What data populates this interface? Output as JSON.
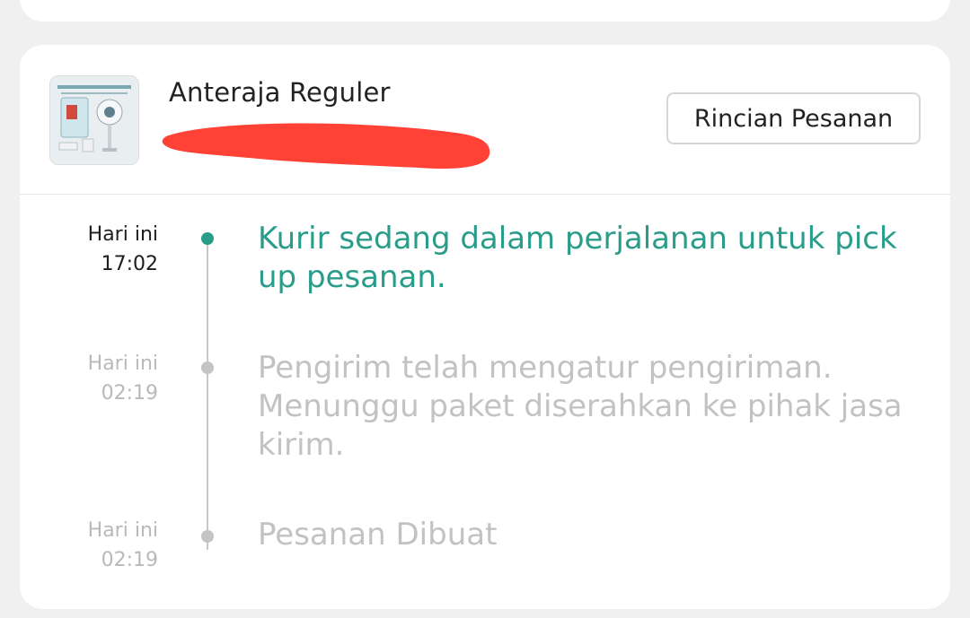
{
  "shipment": {
    "courier": "Anteraja Reguler",
    "details_button": "Rincian Pesanan"
  },
  "colors": {
    "active": "#2a9d8a",
    "inactive": "#c2c2c2",
    "redaction": "#ff4136"
  },
  "timeline": [
    {
      "date": "Hari ini",
      "time": "17:02",
      "text": "Kurir sedang dalam perjalanan untuk pick up pesanan.",
      "active": true
    },
    {
      "date": "Hari ini",
      "time": "02:19",
      "text": "Pengirim telah mengatur pengiriman. Menunggu paket diserahkan ke pihak jasa kirim.",
      "active": false
    },
    {
      "date": "Hari ini",
      "time": "02:19",
      "text": "Pesanan Dibuat",
      "active": false
    }
  ]
}
